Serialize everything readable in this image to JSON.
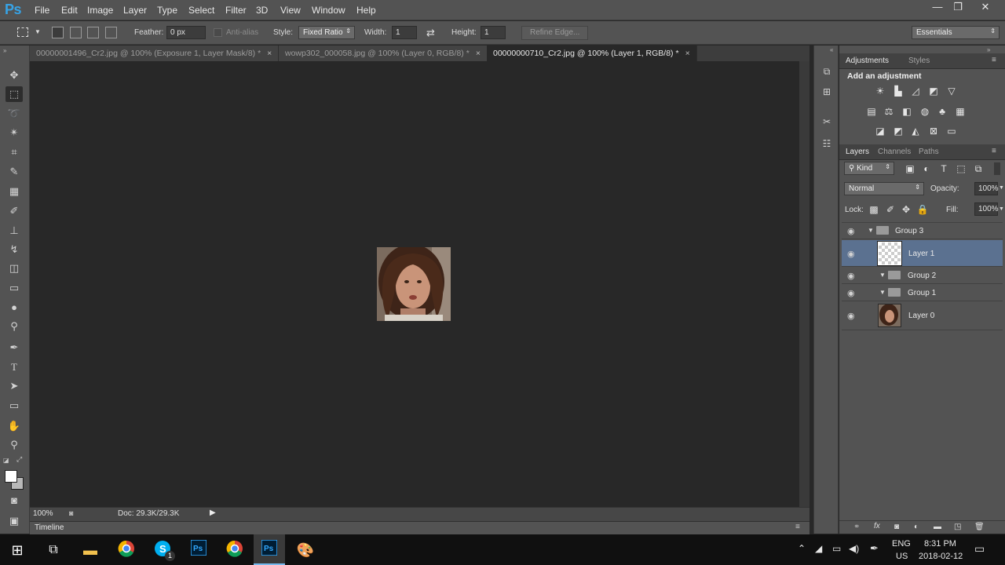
{
  "app": {
    "logo": "Ps"
  },
  "menu": [
    "File",
    "Edit",
    "Image",
    "Layer",
    "Type",
    "Select",
    "Filter",
    "3D",
    "View",
    "Window",
    "Help"
  ],
  "window_controls": {
    "minimize": "—",
    "restore": "❐",
    "close": "✕"
  },
  "options": {
    "feather_label": "Feather:",
    "feather_value": "0 px",
    "antialias_label": "Anti-alias",
    "style_label": "Style:",
    "style_value": "Fixed Ratio",
    "width_label": "Width:",
    "width_value": "1",
    "height_label": "Height:",
    "height_value": "1",
    "refine_edge": "Refine Edge...",
    "workspace": "Essentials"
  },
  "tabs": [
    {
      "label": "00000001496_Cr2.jpg @ 100% (Exposure 1, Layer Mask/8) *",
      "close": "×"
    },
    {
      "label": "wowp302_000058.jpg @ 100% (Layer 0, RGB/8) *",
      "close": "×"
    },
    {
      "label": "00000000710_Cr2.jpg @ 100% (Layer 1, RGB/8) *",
      "close": "×"
    }
  ],
  "status": {
    "zoom": "100%",
    "doc": "Doc: 29.3K/29.3K"
  },
  "timeline": {
    "label": "Timeline"
  },
  "adjustments": {
    "tabs": [
      "Adjustments",
      "Styles"
    ],
    "heading": "Add an adjustment"
  },
  "layers_panel": {
    "tabs": [
      "Layers",
      "Channels",
      "Paths"
    ],
    "filter_kind": "Kind",
    "blend_mode": "Normal",
    "opacity_label": "Opacity:",
    "opacity_value": "100%",
    "lock_label": "Lock:",
    "fill_label": "Fill:",
    "fill_value": "100%",
    "layers": [
      {
        "name": "Group 3",
        "type": "group"
      },
      {
        "name": "Layer 1",
        "type": "layer",
        "selected": true
      },
      {
        "name": "Group 2",
        "type": "group"
      },
      {
        "name": "Group 1",
        "type": "group"
      },
      {
        "name": "Layer 0",
        "type": "layer"
      }
    ]
  },
  "taskbar": {
    "language": "ENG",
    "region": "US",
    "time": "8:31 PM",
    "date": "2018-02-12",
    "skype_badge": "1"
  },
  "colors": {
    "panel_bg": "#535353",
    "canvas_bg": "#282828",
    "selected_layer": "#5b7190",
    "ps_blue": "#37a3e6"
  }
}
